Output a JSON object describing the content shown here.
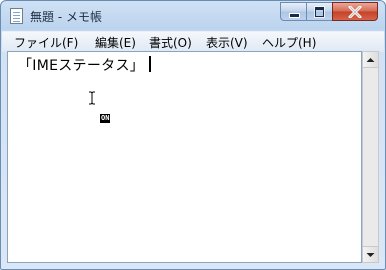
{
  "window": {
    "title": "無題 - メモ帳",
    "icons": {
      "app": "notepad-icon",
      "minimize": "minimize-icon",
      "maximize": "maximize-icon",
      "close": "close-icon"
    }
  },
  "menu": {
    "items": [
      {
        "label": "ファイル(F)"
      },
      {
        "label": "編集(E)"
      },
      {
        "label": "書式(O)"
      },
      {
        "label": "表示(V)"
      },
      {
        "label": "ヘルプ(H)"
      }
    ]
  },
  "editor": {
    "text": "「IMEステータス」",
    "ime_indicator": "ON"
  },
  "colors": {
    "close_button": "#c34328",
    "frame": "#bcd4ee",
    "text": "#000000"
  }
}
